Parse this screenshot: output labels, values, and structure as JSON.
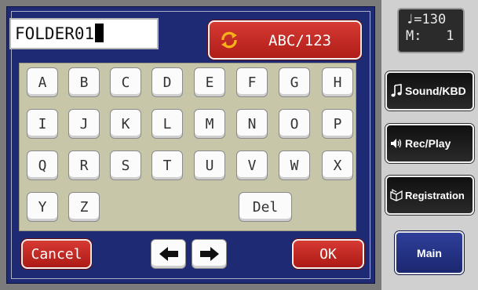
{
  "name_field": {
    "value": "FOLDER01"
  },
  "mode_button": {
    "label": "ABC/123",
    "icon": "cycle-arrows-icon"
  },
  "keyboard": {
    "rows": [
      [
        "A",
        "B",
        "C",
        "D",
        "E",
        "F",
        "G",
        "H"
      ],
      [
        "I",
        "J",
        "K",
        "L",
        "M",
        "N",
        "O",
        "P"
      ],
      [
        "Q",
        "R",
        "S",
        "T",
        "U",
        "V",
        "W",
        "X"
      ],
      [
        "Y",
        "Z"
      ]
    ],
    "del_label": "Del"
  },
  "footer": {
    "cancel_label": "Cancel",
    "ok_label": "OK",
    "left_arrow_icon": "arrow-left-icon",
    "right_arrow_icon": "arrow-right-icon"
  },
  "status": {
    "tempo": "130",
    "measure": "1",
    "measure_label": "M:"
  },
  "side_menu": [
    {
      "label": "Sound/KBD",
      "icon": "music-note-icon"
    },
    {
      "label": "Rec/Play",
      "icon": "speaker-icon"
    },
    {
      "label": "Registration",
      "icon": "book-icon"
    }
  ],
  "main_button": {
    "label": "Main"
  },
  "colors": {
    "panel": "#1f2a74",
    "keyboard_bg": "#c8c6a8",
    "accent_red": "#c4281f",
    "main_blue": "#25338a"
  }
}
